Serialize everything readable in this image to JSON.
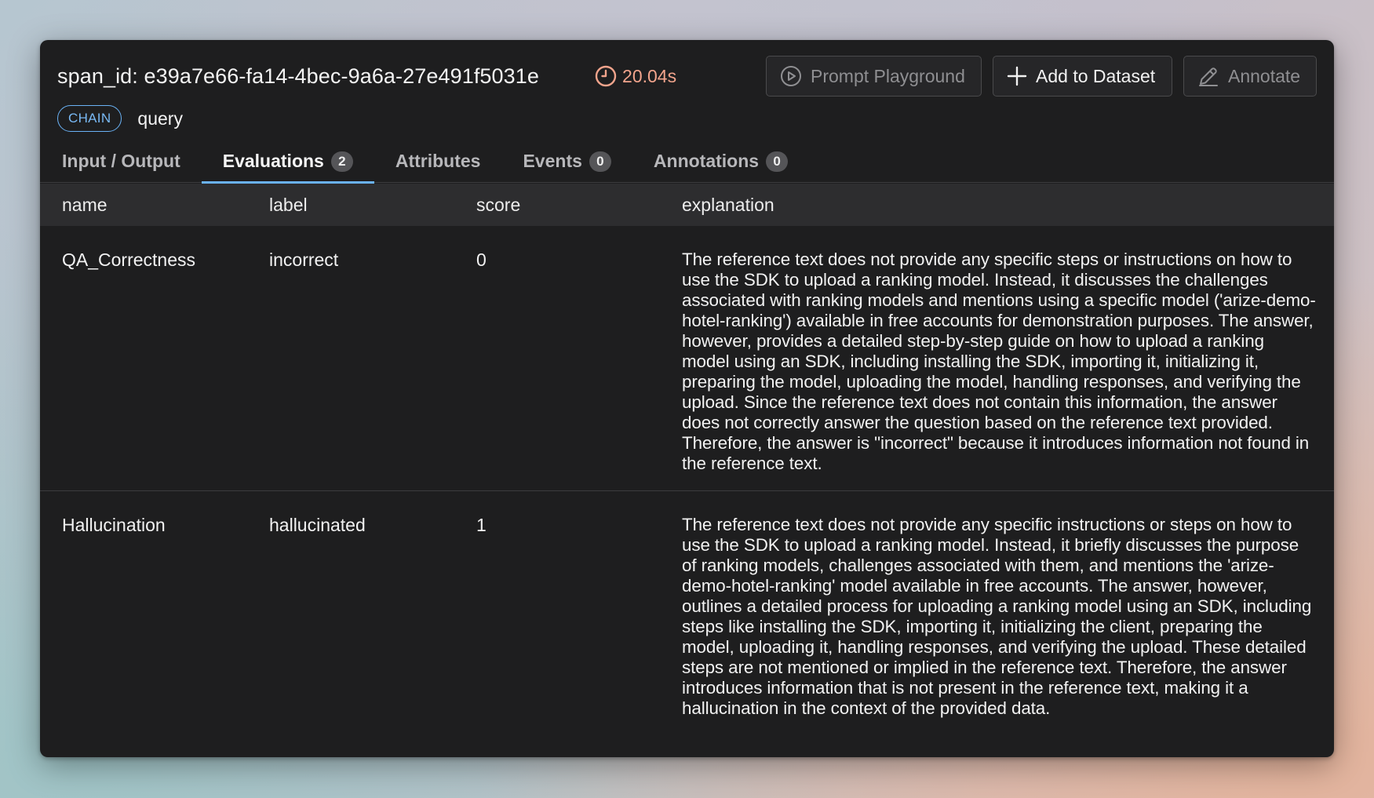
{
  "span": {
    "id_text": "span_id: e39a7e66-fa14-4bec-9a6a-27e491f5031e",
    "latency": "20.04s",
    "kind": "CHAIN",
    "name": "query"
  },
  "actions": {
    "prompt_playground": "Prompt Playground",
    "add_to_dataset": "Add to Dataset",
    "annotate": "Annotate"
  },
  "tabs": [
    {
      "label": "Input / Output"
    },
    {
      "label": "Evaluations",
      "count": "2"
    },
    {
      "label": "Attributes"
    },
    {
      "label": "Events",
      "count": "0"
    },
    {
      "label": "Annotations",
      "count": "0"
    }
  ],
  "table": {
    "columns": [
      "name",
      "label",
      "score",
      "explanation"
    ],
    "rows": [
      {
        "name": "QA_Correctness",
        "label": "incorrect",
        "score": "0",
        "explanation": "The reference text does not provide any specific steps or instructions on how to use the SDK to upload a ranking model. Instead, it discusses the challenges associated with ranking models and mentions using a specific model ('arize-demo-hotel-ranking') available in free accounts for demonstration purposes. The answer, however, provides a detailed step-by-step guide on how to upload a ranking model using an SDK, including installing the SDK, importing it, initializing it, preparing the model, uploading the model, handling responses, and verifying the upload. Since the reference text does not contain this information, the answer does not correctly answer the question based on the reference text provided. Therefore, the answer is \"incorrect\" because it introduces information not found in the reference text."
      },
      {
        "name": "Hallucination",
        "label": "hallucinated",
        "score": "1",
        "explanation": "The reference text does not provide any specific instructions or steps on how to use the SDK to upload a ranking model. Instead, it briefly discusses the purpose of ranking models, challenges associated with them, and mentions the 'arize-demo-hotel-ranking' model available in free accounts. The answer, however, outlines a detailed process for uploading a ranking model using an SDK, including steps like installing the SDK, importing it, initializing the client, preparing the model, uploading it, handling responses, and verifying the upload. These detailed steps are not mentioned or implied in the reference text. Therefore, the answer introduces information that is not present in the reference text, making it a hallucination in the context of the provided data."
      }
    ]
  },
  "colors": {
    "panel": "#1e1e1f",
    "accent": "#6ab2f5",
    "latency": "#f2a48c"
  },
  "icons": {
    "latency": "clock-icon",
    "prompt_playground": "play-circle-icon",
    "add_to_dataset": "plus-icon",
    "annotate": "pencil-icon"
  }
}
